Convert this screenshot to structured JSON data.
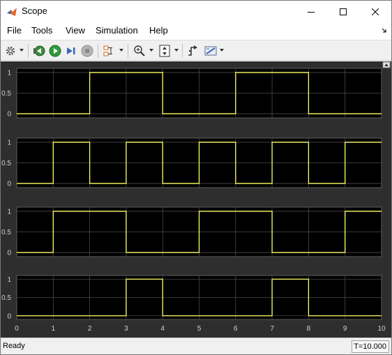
{
  "window": {
    "title": "Scope"
  },
  "menu": [
    "File",
    "Tools",
    "View",
    "Simulation",
    "Help"
  ],
  "toolbar": {
    "icons": [
      "settings-icon",
      "step-back-icon",
      "run-icon",
      "step-forward-icon",
      "stop-icon",
      "signal-select-icon",
      "zoom-icon",
      "autoscale-icon",
      "trigger-icon",
      "measurement-icon"
    ]
  },
  "status": {
    "text": "Ready",
    "time": "T=10.000"
  },
  "colors": {
    "plot_bg": "#000000",
    "figure_bg": "#2e2e2e",
    "signal": "#ffff66",
    "grid": "#4a4a4a",
    "axis_text": "#d0d0d0"
  },
  "chart_data": [
    {
      "type": "line",
      "step": true,
      "x": [
        0,
        1,
        2,
        3,
        4,
        5,
        6,
        7,
        8,
        9,
        10
      ],
      "values": [
        0,
        0,
        1,
        1,
        0,
        0,
        1,
        1,
        0,
        0,
        1
      ],
      "xlim": [
        0,
        10
      ],
      "ylim": [
        -0.1,
        1.1
      ],
      "yticks": [
        0,
        0.5,
        1
      ],
      "ytick_labels": [
        "0",
        "0.5",
        "1"
      ],
      "grid": true
    },
    {
      "type": "line",
      "step": true,
      "x": [
        0,
        1,
        2,
        3,
        4,
        5,
        6,
        7,
        8,
        9,
        10
      ],
      "values": [
        0,
        1,
        0,
        1,
        0,
        1,
        0,
        1,
        0,
        1,
        1
      ],
      "xlim": [
        0,
        10
      ],
      "ylim": [
        -0.1,
        1.1
      ],
      "yticks": [
        0,
        0.5,
        1
      ],
      "ytick_labels": [
        "0",
        "0.5",
        "1"
      ],
      "grid": true
    },
    {
      "type": "line",
      "step": true,
      "x": [
        0,
        1,
        2,
        3,
        4,
        5,
        6,
        7,
        8,
        9,
        10
      ],
      "values": [
        0,
        1,
        1,
        0,
        0,
        1,
        1,
        0,
        0,
        1,
        1
      ],
      "xlim": [
        0,
        10
      ],
      "ylim": [
        -0.1,
        1.1
      ],
      "yticks": [
        0,
        0.5,
        1
      ],
      "ytick_labels": [
        "0",
        "0.5",
        "1"
      ],
      "grid": true
    },
    {
      "type": "line",
      "step": true,
      "x": [
        0,
        1,
        2,
        3,
        4,
        5,
        6,
        7,
        8,
        9,
        10
      ],
      "values": [
        0,
        0,
        0,
        1,
        0,
        0,
        0,
        1,
        0,
        0,
        0
      ],
      "xlim": [
        0,
        10
      ],
      "ylim": [
        -0.1,
        1.1
      ],
      "yticks": [
        0,
        0.5,
        1
      ],
      "ytick_labels": [
        "0",
        "0.5",
        "1"
      ],
      "xticks": [
        0,
        1,
        2,
        3,
        4,
        5,
        6,
        7,
        8,
        9,
        10
      ],
      "xtick_labels": [
        "0",
        "1",
        "2",
        "3",
        "4",
        "5",
        "6",
        "7",
        "8",
        "9",
        "10"
      ],
      "grid": true
    }
  ]
}
